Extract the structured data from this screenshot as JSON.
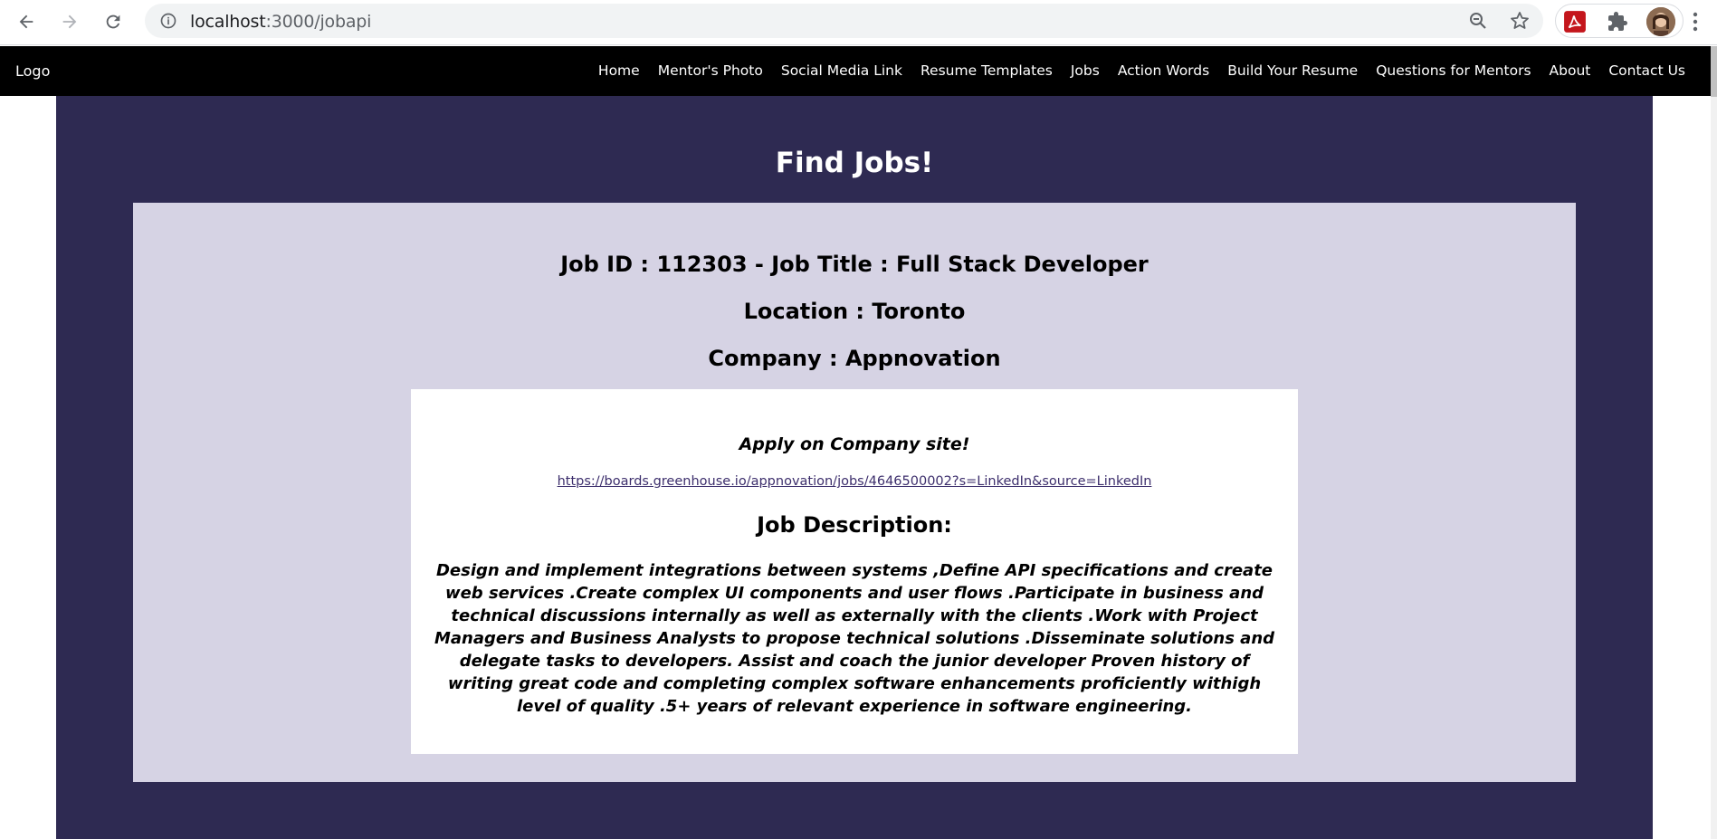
{
  "browser": {
    "url_host": "localhost",
    "url_path": ":3000/jobapi"
  },
  "navbar": {
    "logo": "Logo",
    "links": [
      {
        "label": "Home"
      },
      {
        "label": "Mentor's Photo"
      },
      {
        "label": "Social Media Link"
      },
      {
        "label": "Resume Templates"
      },
      {
        "label": "Jobs"
      },
      {
        "label": "Action Words"
      },
      {
        "label": "Build Your Resume"
      },
      {
        "label": "Questions for Mentors"
      },
      {
        "label": "About"
      },
      {
        "label": "Contact Us"
      }
    ]
  },
  "main": {
    "title": "Find Jobs!",
    "job": {
      "id_title": "Job ID : 112303 - Job Title : Full Stack Developer",
      "location": "Location : Toronto",
      "company": "Company : Appnovation",
      "apply_label": "Apply on Company site!",
      "apply_url": "https://boards.greenhouse.io/appnovation/jobs/4646500002?s=LinkedIn&source=LinkedIn",
      "description_heading": "Job Description:",
      "description": "Design and implement integrations between systems ,Define API specifications and create web services .Create complex UI components and user flows .Participate in business and technical discussions internally as well as externally with the clients .Work with Project Managers and Business Analysts to propose technical solutions .Disseminate solutions and delegate tasks to developers. Assist and coach the junior developer Proven history of writing great code and completing complex software enhancements proficiently withigh level of quality .5+ years of relevant experience in software engineering."
    }
  },
  "colors": {
    "navbar_bg": "#000000",
    "main_bg": "#2e2a52",
    "card_bg": "#d6d3e4",
    "inner_bg": "#ffffff"
  },
  "icons": [
    "back-arrow-icon",
    "forward-arrow-icon",
    "reload-icon",
    "info-icon",
    "zoom-icon",
    "star-icon",
    "pdf-extension-icon",
    "puzzle-icon",
    "avatar",
    "kebab-menu-icon"
  ]
}
